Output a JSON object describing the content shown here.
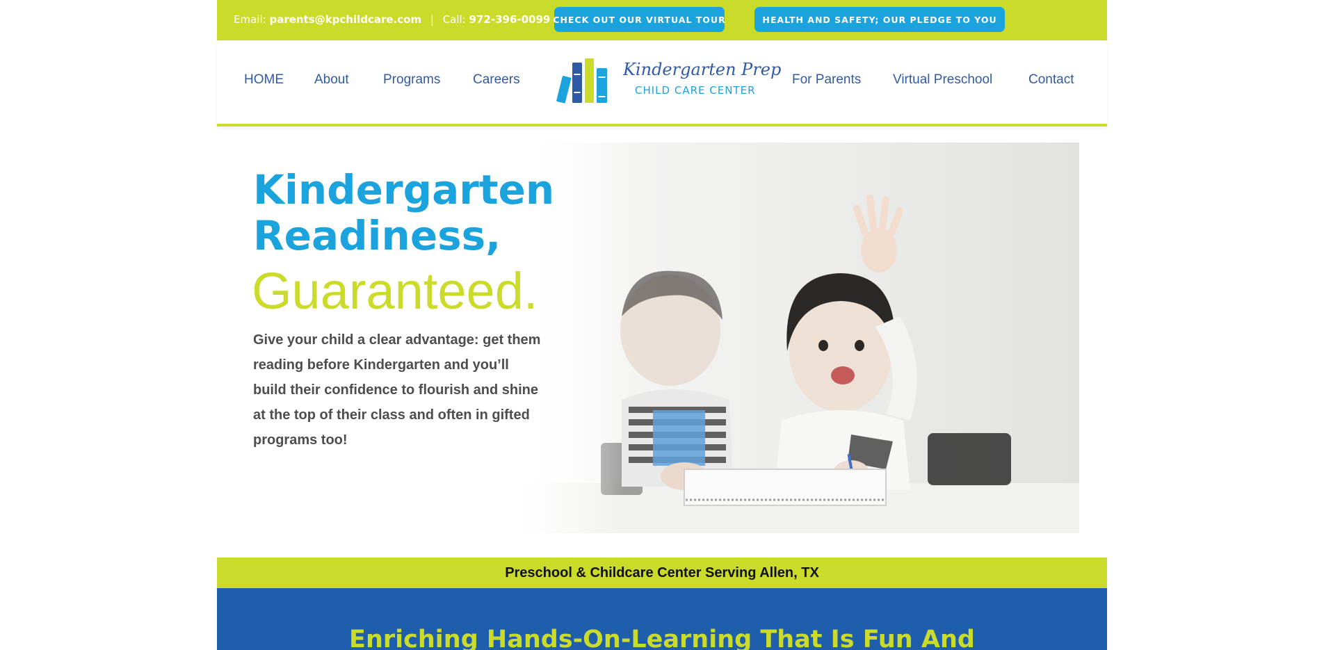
{
  "topbar": {
    "email_label": "Email:",
    "email": "parents@kpchildcare.com",
    "separator": "|",
    "call_label": "Call:",
    "phone": "972-396-0099",
    "virtual_tour_button": "CHECK OUT OUR VIRTUAL TOUR",
    "health_safety_button": "HEALTH AND SAFETY; OUR PLEDGE TO YOU"
  },
  "nav": {
    "left": [
      "HOME",
      "About",
      "Programs",
      "Careers"
    ],
    "right": [
      "For Parents",
      "Virtual Preschool",
      "Contact"
    ]
  },
  "logo": {
    "title": "Kindergarten Prep",
    "subtitle": "CHILD CARE CENTER"
  },
  "hero": {
    "line1": "Kindergarten",
    "line2": "Readiness,",
    "line3": "Guaranteed.",
    "body": "Give your child a clear advantage: get them reading before Kindergarten and you’ll build their confidence to flourish and shine at the top of their class and often in gifted programs too!"
  },
  "strip": {
    "text": "Preschool & Childcare Center Serving Allen, TX"
  },
  "section": {
    "heading": "Enriching Hands-On-Learning That Is Fun And"
  },
  "colors": {
    "lime": "#cbdb2a",
    "sky_blue": "#1ba3dd",
    "nav_blue": "#2f5aa5",
    "section_blue": "#1e5eab"
  }
}
